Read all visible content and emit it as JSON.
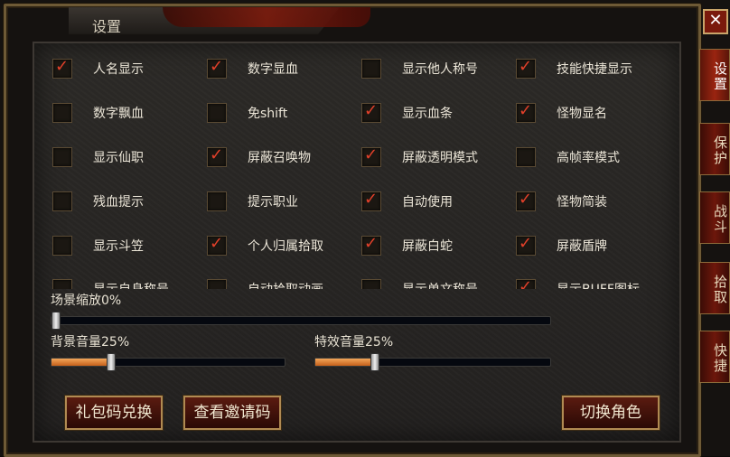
{
  "window": {
    "title": "设置",
    "close_glyph": "✕"
  },
  "side_tabs": [
    {
      "label": "设置",
      "active": true
    },
    {
      "label": "保护",
      "active": false
    },
    {
      "label": "战斗",
      "active": false
    },
    {
      "label": "拾取",
      "active": false
    },
    {
      "label": "快捷",
      "active": false
    }
  ],
  "options": [
    {
      "label": "人名显示",
      "checked": true
    },
    {
      "label": "数字显血",
      "checked": true
    },
    {
      "label": "显示他人称号",
      "checked": false
    },
    {
      "label": "技能快捷显示",
      "checked": true
    },
    {
      "label": "数字飘血",
      "checked": false
    },
    {
      "label": "免shift",
      "checked": false
    },
    {
      "label": "显示血条",
      "checked": true
    },
    {
      "label": "怪物显名",
      "checked": true
    },
    {
      "label": "显示仙职",
      "checked": false
    },
    {
      "label": "屏蔽召唤物",
      "checked": true
    },
    {
      "label": "屏蔽透明模式",
      "checked": true
    },
    {
      "label": "高帧率模式",
      "checked": false
    },
    {
      "label": "残血提示",
      "checked": false
    },
    {
      "label": "提示职业",
      "checked": false
    },
    {
      "label": "自动使用",
      "checked": true
    },
    {
      "label": "怪物简装",
      "checked": true
    },
    {
      "label": "显示斗笠",
      "checked": false
    },
    {
      "label": "个人归属拾取",
      "checked": true
    },
    {
      "label": "屏蔽白蛇",
      "checked": true
    },
    {
      "label": "屏蔽盾牌",
      "checked": true
    },
    {
      "label": "显示自身称号",
      "checked": false
    },
    {
      "label": "自动拾取动画",
      "checked": false
    },
    {
      "label": "显示单文称号",
      "checked": false
    },
    {
      "label": "显示BUFF图标",
      "checked": true
    }
  ],
  "sliders": {
    "scene_zoom": {
      "label": "场景缩放0%",
      "value": 0
    },
    "bgm_volume": {
      "label": "背景音量25%",
      "value": 25
    },
    "sfx_volume": {
      "label": "特效音量25%",
      "value": 25
    }
  },
  "buttons": {
    "gift_code": "礼包码兑换",
    "invite_code": "查看邀请码",
    "switch_role": "切换角色"
  },
  "icons": {
    "check": "✓",
    "close": "close-icon"
  },
  "colors": {
    "check": "#e2402a",
    "accent": "#c5611b",
    "frame": "#6e5a36"
  }
}
